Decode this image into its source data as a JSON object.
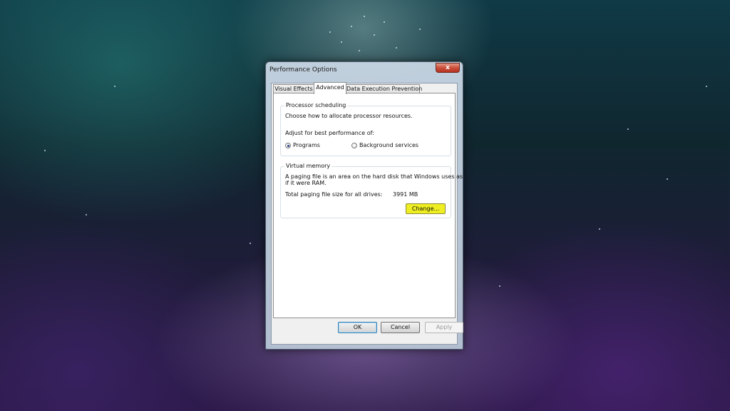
{
  "window": {
    "title": "Performance Options",
    "close_label": "x"
  },
  "tabs": [
    {
      "label": "Visual Effects",
      "selected": false
    },
    {
      "label": "Advanced",
      "selected": true
    },
    {
      "label": "Data Execution Prevention",
      "selected": false
    }
  ],
  "processor": {
    "group_label": "Processor scheduling",
    "description": "Choose how to allocate processor resources.",
    "adjust_label": "Adjust for best performance of:",
    "options": [
      {
        "label": "Programs",
        "selected": true
      },
      {
        "label": "Background services",
        "selected": false
      }
    ]
  },
  "virtual_memory": {
    "group_label": "Virtual memory",
    "description_line1": "A paging file is an area on the hard disk that Windows uses as",
    "description_line2": "if it were RAM.",
    "total_label": "Total paging file size for all drives:",
    "total_value": "3991 MB",
    "change_button": "Change..."
  },
  "buttons": {
    "ok": "OK",
    "cancel": "Cancel",
    "apply": "Apply"
  },
  "colors": {
    "highlight": "#eeee22",
    "close_button": "#c9503c"
  }
}
